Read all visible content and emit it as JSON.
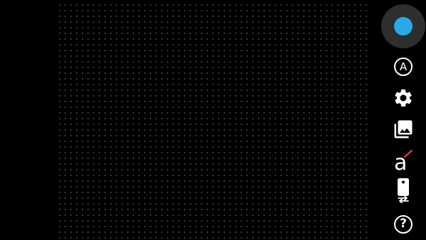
{
  "colors": {
    "accent": "#2aa9e8",
    "background": "#000000",
    "dots": "#8a8a8a",
    "icon": "#ffffff",
    "edit_mark": "#e53935"
  },
  "toolbar": {
    "shutter": {
      "icon": "shutter-button"
    },
    "auto_mode": {
      "label": "A",
      "icon": "auto-mode-icon"
    },
    "settings": {
      "icon": "gear-icon"
    },
    "gallery": {
      "icon": "photo-library-icon"
    },
    "text_tool": {
      "label": "a",
      "icon": "text-edit-icon"
    },
    "switch_camera": {
      "icon": "switch-camera-icon"
    },
    "help": {
      "label": "?",
      "icon": "help-icon"
    }
  }
}
